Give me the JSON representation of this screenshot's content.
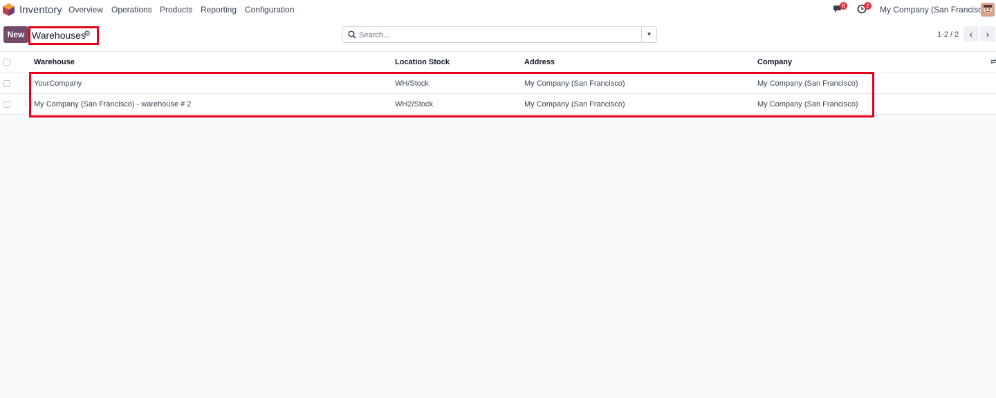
{
  "navbar": {
    "app_name": "Inventory",
    "menus": [
      "Overview",
      "Operations",
      "Products",
      "Reporting",
      "Configuration"
    ],
    "messages_count": "8",
    "activities_count": "2",
    "company": "My Company (San Francisco)"
  },
  "control_panel": {
    "new_label": "New",
    "title": "Warehouses",
    "search_placeholder": "Search...",
    "pager": "1-2 / 2"
  },
  "table": {
    "columns": [
      "Warehouse",
      "Location Stock",
      "Address",
      "Company"
    ],
    "rows": [
      [
        "YourCompany",
        "WH/Stock",
        "My Company (San Francisco)",
        "My Company (San Francisco)"
      ],
      [
        "My Company (San Francisco) - warehouse # 2",
        "WH2/Stock",
        "My Company (San Francisco)",
        "My Company (San Francisco)"
      ]
    ]
  },
  "colors": {
    "brand": "#714b67",
    "highlight": "#e5001d",
    "badge": "#e0313b"
  }
}
